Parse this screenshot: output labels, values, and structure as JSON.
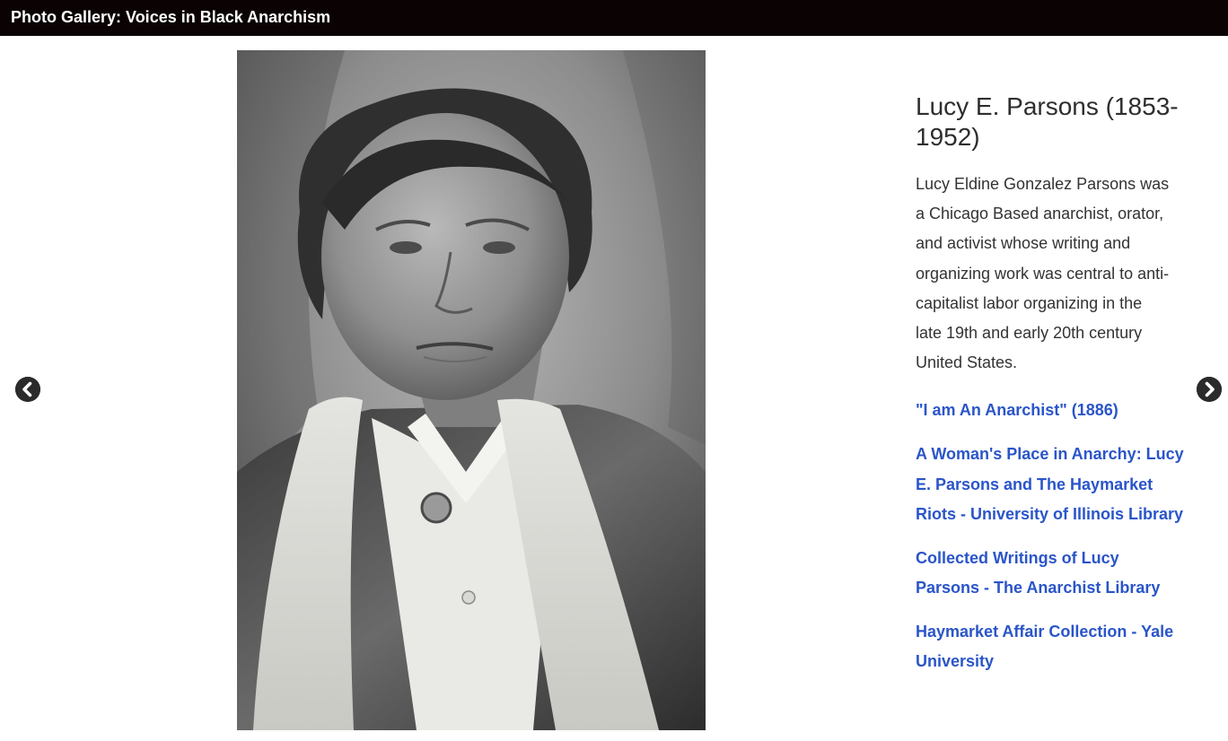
{
  "header": {
    "title": "Photo Gallery: Voices in Black Anarchism"
  },
  "navigation": {
    "prev_icon": "chevron-left-circle",
    "next_icon": "chevron-right-circle"
  },
  "photo": {
    "subject": "Lucy E. Parsons"
  },
  "caption": {
    "title": "Lucy E. Parsons (1853-1952)",
    "body": "Lucy Eldine Gonzalez Parsons was a Chicago Based anarchist, orator, and activist whose writing and organizing work was central to anti-capitalist labor organizing in the late 19th and early 20th century United States.",
    "links": [
      {
        "label": "\"I am An Anarchist\" (1886)"
      },
      {
        "label": "A Woman's Place in Anarchy: Lucy E. Parsons and The Haymarket Riots - University of Illinois Library"
      },
      {
        "label": "Collected Writings of Lucy Parsons - The Anarchist Library"
      },
      {
        "label": "Haymarket Affair Collection - Yale University"
      }
    ]
  },
  "colors": {
    "header_bg": "#0b0303",
    "link": "#2a55c9",
    "text": "#333333"
  }
}
